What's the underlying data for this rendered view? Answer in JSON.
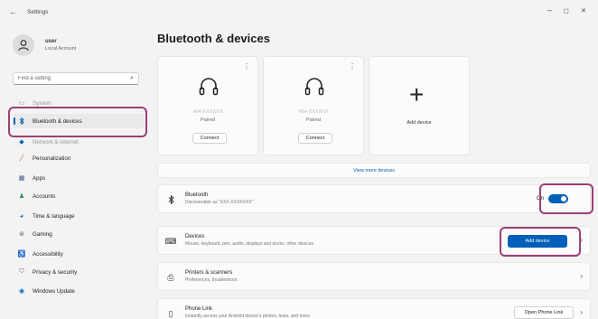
{
  "window": {
    "back_glyph": "←",
    "title": "Settings",
    "minimize_glyph": "–",
    "maximize_glyph": "◻",
    "close_glyph": "✕"
  },
  "profile": {
    "name": "user",
    "account": "Local Account"
  },
  "search": {
    "placeholder": "Find a setting"
  },
  "sidebar": {
    "items": [
      {
        "label": "System",
        "icon": "monitor-icon"
      },
      {
        "label": "Bluetooth & devices",
        "icon": "bluetooth-icon"
      },
      {
        "label": "Network & internet",
        "icon": "wifi-icon"
      },
      {
        "label": "Personalization",
        "icon": "brush-icon"
      },
      {
        "label": "Apps",
        "icon": "apps-icon"
      },
      {
        "label": "Accounts",
        "icon": "person-icon"
      },
      {
        "label": "Time & language",
        "icon": "globe-clock-icon"
      },
      {
        "label": "Gaming",
        "icon": "gamepad-icon"
      },
      {
        "label": "Accessibility",
        "icon": "accessibility-icon"
      },
      {
        "label": "Privacy & security",
        "icon": "shield-icon"
      },
      {
        "label": "Windows Update",
        "icon": "update-icon"
      }
    ]
  },
  "main": {
    "title": "Bluetooth & devices",
    "device_cards": [
      {
        "name": "WH-XXXXXX",
        "status": "Paired",
        "button": "Connect"
      },
      {
        "name": "WH-XXXXXX",
        "status": "Paired",
        "button": "Connect"
      }
    ],
    "add_card_label": "Add device",
    "view_more": "View more devices",
    "bluetooth_row": {
      "title": "Bluetooth",
      "subtitle": "Discoverable as \"XXX-XXXXXXX\"",
      "toggle_label": "On"
    },
    "devices_row": {
      "title": "Devices",
      "subtitle": "Mouse, keyboard, pen, audio, displays and docks, other devices",
      "button": "Add device"
    },
    "printers_row": {
      "title": "Printers & scanners",
      "subtitle": "Preferences, troubleshoot"
    },
    "phone_row": {
      "title": "Phone Link",
      "subtitle": "Instantly access your Android device's photos, texts, and more",
      "button": "Open Phone Link"
    }
  },
  "colors": {
    "accent": "#005fb8",
    "highlight": "#9c3f78"
  }
}
